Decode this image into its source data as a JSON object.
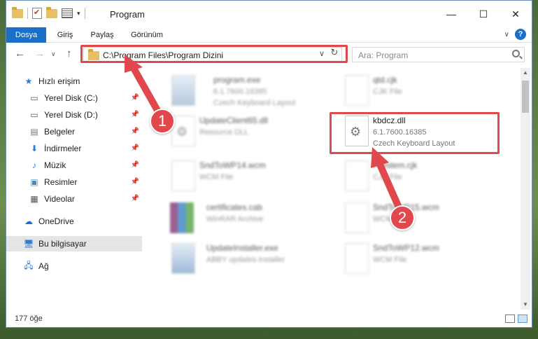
{
  "window": {
    "title": "Program",
    "controls": {
      "minimize": "—",
      "maximize": "☐",
      "close": "✕"
    }
  },
  "ribbon": {
    "tabs": [
      "Dosya",
      "Giriş",
      "Paylaş",
      "Görünüm"
    ],
    "help": "?"
  },
  "nav": {
    "back": "←",
    "forward": "→",
    "recent": "∨",
    "up": "↑",
    "address": "C:\\Program Files\\Program Dizini",
    "dropdown": "∨",
    "refresh": "↻",
    "search_placeholder": "Ara: Program"
  },
  "sidebar": {
    "items": [
      {
        "label": "Hızlı erişim",
        "icon": "star-icon"
      },
      {
        "label": "Yerel Disk (C:)",
        "icon": "drive-icon"
      },
      {
        "label": "Yerel Disk (D:)",
        "icon": "drive-icon"
      },
      {
        "label": "Belgeler",
        "icon": "documents-icon"
      },
      {
        "label": "İndirmeler",
        "icon": "download-icon"
      },
      {
        "label": "Müzik",
        "icon": "music-icon"
      },
      {
        "label": "Resimler",
        "icon": "pictures-icon"
      },
      {
        "label": "Videolar",
        "icon": "video-icon"
      },
      {
        "label": "OneDrive",
        "icon": "cloud-icon"
      },
      {
        "label": "Bu bilgisayar",
        "icon": "computer-icon"
      },
      {
        "label": "Ağ",
        "icon": "network-icon"
      }
    ]
  },
  "files": [
    {
      "name": "program.exe",
      "l2": "6.1.7600.16385",
      "l3": "Czech Keyboard Layout",
      "type": "exe"
    },
    {
      "name": "qtd.cjk",
      "l2": "CJK File",
      "l3": "",
      "type": "doc"
    },
    {
      "name": "UpdateClient65.dll",
      "l2": "Resource DLL",
      "l3": "",
      "type": "dll"
    },
    {
      "name": "kbdcz.dll",
      "l2": "6.1.7600.16385",
      "l3": "Czech Keyboard Layout",
      "type": "dll"
    },
    {
      "name": "SndToWP14.wcm",
      "l2": "WCM File",
      "l3": "",
      "type": "doc"
    },
    {
      "name": "Fsystem.cjk",
      "l2": "CJK File",
      "l3": "",
      "type": "doc"
    },
    {
      "name": "certificates.cab",
      "l2": "WinRAR Archive",
      "l3": "",
      "type": "rar"
    },
    {
      "name": "SndToWP15.wcm",
      "l2": "WCM File",
      "l3": "",
      "type": "doc"
    },
    {
      "name": "UpdateInstaller.exe",
      "l2": "ABBY updates installer",
      "l3": "",
      "type": "inst"
    },
    {
      "name": "SndToWP12.wcm",
      "l2": "WCM File",
      "l3": "",
      "type": "doc"
    }
  ],
  "steps": [
    "1",
    "2"
  ],
  "status": {
    "count": "177 öğe"
  },
  "colors": {
    "accent": "#1a6fc9",
    "highlight": "#e0484d"
  }
}
